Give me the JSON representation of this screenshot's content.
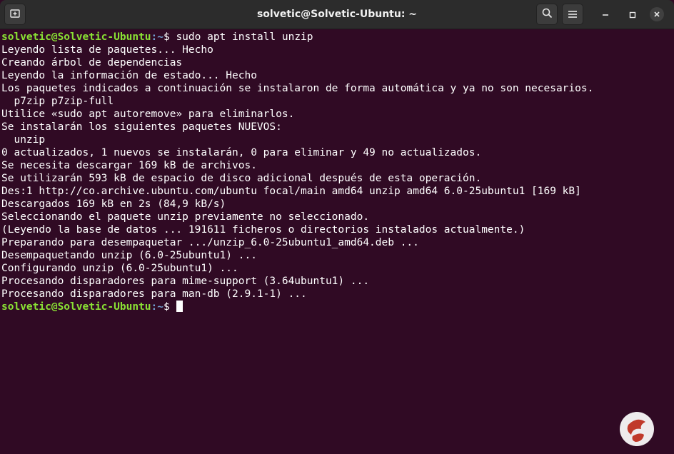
{
  "window": {
    "title": "solvetic@Solvetic-Ubuntu: ~"
  },
  "prompt": {
    "user_host": "solvetic@Solvetic-Ubuntu",
    "path": ":~",
    "symbol": "$ "
  },
  "command": "sudo apt install unzip",
  "output_lines": [
    "Leyendo lista de paquetes... Hecho",
    "Creando árbol de dependencias",
    "Leyendo la información de estado... Hecho",
    "Los paquetes indicados a continuación se instalaron de forma automática y ya no son necesarios.",
    "  p7zip p7zip-full",
    "Utilice «sudo apt autoremove» para eliminarlos.",
    "Se instalarán los siguientes paquetes NUEVOS:",
    "  unzip",
    "0 actualizados, 1 nuevos se instalarán, 0 para eliminar y 49 no actualizados.",
    "Se necesita descargar 169 kB de archivos.",
    "Se utilizarán 593 kB de espacio de disco adicional después de esta operación.",
    "Des:1 http://co.archive.ubuntu.com/ubuntu focal/main amd64 unzip amd64 6.0-25ubuntu1 [169 kB]",
    "Descargados 169 kB en 2s (84,9 kB/s)",
    "Seleccionando el paquete unzip previamente no seleccionado.",
    "(Leyendo la base de datos ... 191611 ficheros o directorios instalados actualmente.)",
    "Preparando para desempaquetar .../unzip_6.0-25ubuntu1_amd64.deb ...",
    "Desempaquetando unzip (6.0-25ubuntu1) ...",
    "Configurando unzip (6.0-25ubuntu1) ...",
    "Procesando disparadores para mime-support (3.64ubuntu1) ...",
    "Procesando disparadores para man-db (2.9.1-1) ..."
  ],
  "colors": {
    "terminal_bg": "#300a24",
    "prompt_user": "#8ae234",
    "prompt_path": "#729fcf",
    "text": "#ffffff",
    "titlebar": "#2c2c2c"
  },
  "icons": {
    "new_tab": "new-tab-icon",
    "search": "search-icon",
    "menu": "hamburger-menu-icon",
    "minimize": "minimize-icon",
    "maximize": "maximize-icon",
    "close": "close-icon",
    "watermark": "watermark-logo"
  }
}
